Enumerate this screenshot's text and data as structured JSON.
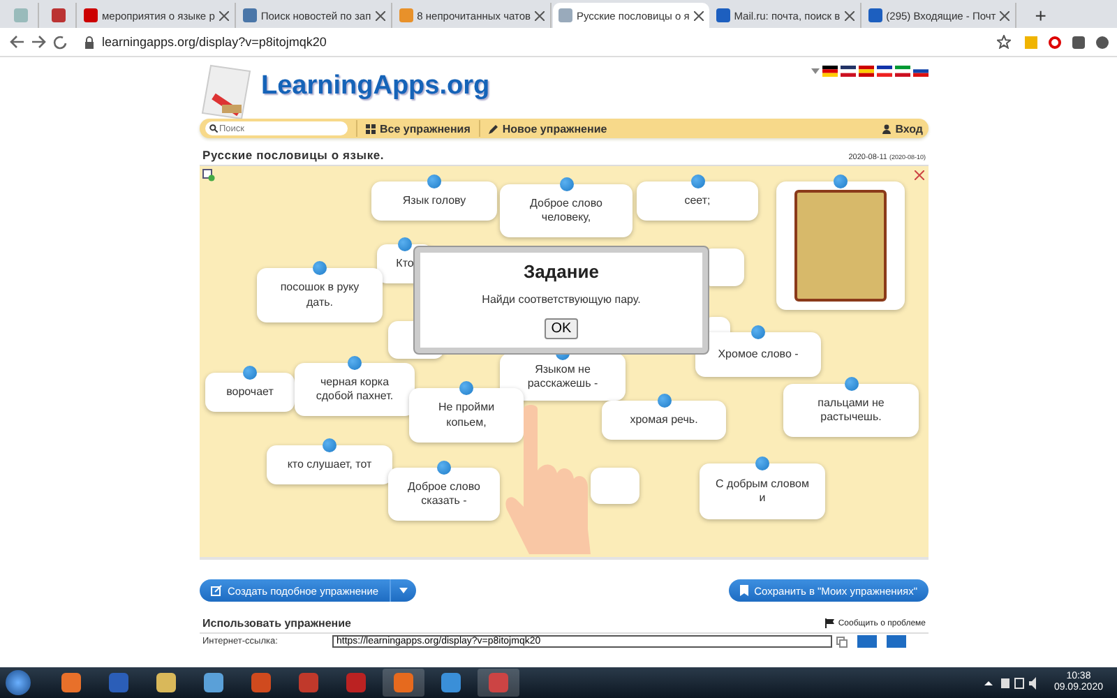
{
  "browser": {
    "tabs": [
      {
        "kind": "pinned",
        "selected": false
      },
      {
        "kind": "pinned",
        "selected": false
      },
      {
        "kind": "tab",
        "title": "мероприятия о языке р",
        "selected": false
      },
      {
        "kind": "tab",
        "title": "Поиск новостей по зап",
        "selected": false
      },
      {
        "kind": "tab",
        "title": "8 непрочитанных чатов",
        "selected": false
      },
      {
        "kind": "tab",
        "title": "Русские пословицы о я",
        "selected": true
      },
      {
        "kind": "tab",
        "title": "Mail.ru: почта, поиск в",
        "selected": false
      },
      {
        "kind": "tab",
        "title": "(295) Входящие - Почт",
        "selected": false
      }
    ],
    "new_tab": "+",
    "address": "learningapps.org/display?v=p8itojmqk20"
  },
  "site": {
    "logo": "LearningApps.org",
    "search": {
      "placeholder": "Поиск"
    },
    "nav": [
      "Все упражнения",
      "Новое упражнение"
    ],
    "login": "Вход"
  },
  "exercise": {
    "title": "Русские пословицы о языке.",
    "date": "2020-08-11",
    "date_original": "(2020-08-10)",
    "cards": [
      {
        "kind": "text",
        "text": "Язык голову"
      },
      {
        "kind": "text",
        "text": "Доброе слово человеку,"
      },
      {
        "kind": "text",
        "text": "сеет;"
      },
      {
        "kind": "image"
      },
      {
        "kind": "text",
        "text": "Кто"
      },
      {
        "kind": "covered"
      },
      {
        "kind": "text",
        "text": "посошок в руку дать."
      },
      {
        "kind": "covered"
      },
      {
        "kind": "covered"
      },
      {
        "kind": "text",
        "text": "Хромое слово -"
      },
      {
        "kind": "text",
        "text": "Языком не расскажешь -"
      },
      {
        "kind": "text",
        "text": "ворочает"
      },
      {
        "kind": "text",
        "text": "черная корка сдобой пахнет."
      },
      {
        "kind": "text",
        "text": "Не пройми копьем,"
      },
      {
        "kind": "text",
        "text": "хромая речь."
      },
      {
        "kind": "text",
        "text": "пальцами не растычешь."
      },
      {
        "kind": "text",
        "text": "кто слушает, тот"
      },
      {
        "kind": "text",
        "text": "Доброе слово сказать -"
      },
      {
        "kind": "covered"
      },
      {
        "kind": "text",
        "text": "С добрым словом и"
      }
    ],
    "dialog": {
      "title": "Задание",
      "text": "Найди соответствующую пару.",
      "button": "OK"
    }
  },
  "actions": {
    "create": "Создать подобное упражнение",
    "save": "Сохранить в \"Моих упражнениях\""
  },
  "use": {
    "heading": "Использовать упражнение",
    "report": "Сообщить о проблеме",
    "link_label": "Интернет-ссылка:",
    "link_value": "https://learningapps.org/display?v=p8itojmqk20"
  },
  "taskbar": {
    "time": "10:38",
    "date": "09.09.2020"
  }
}
